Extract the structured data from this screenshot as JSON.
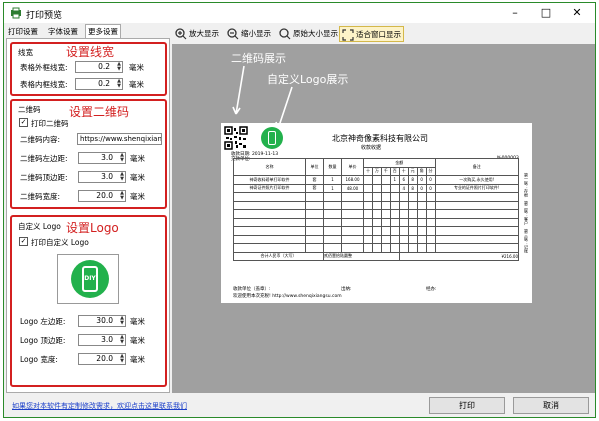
{
  "window": {
    "title": "打印预览",
    "minimize": "–",
    "maximize": "□",
    "close": "✕"
  },
  "tabs": [
    "打印设置",
    "字体设置",
    "更多设置"
  ],
  "line_group": {
    "header": "线宽",
    "annotation": "设置线宽",
    "outer_label": "表格外框线宽:",
    "outer_value": "0.2",
    "inner_label": "表格内框线宽:",
    "inner_value": "0.2",
    "unit": "毫米"
  },
  "qr_group": {
    "header": "二维码",
    "annotation": "设置二维码",
    "print_label": "打印二维码",
    "print_checked": "✓",
    "content_label": "二维码内容:",
    "content_value": "https://www.shenqixiangsu.com",
    "left_label": "二维码左边距:",
    "left_value": "3.0",
    "top_label": "二维码顶边距:",
    "top_value": "3.0",
    "width_label": "二维码宽度:",
    "width_value": "20.0",
    "unit": "毫米"
  },
  "logo_group": {
    "header": "自定义 Logo",
    "annotation": "设置Logo",
    "print_label": "打印自定义 Logo",
    "print_checked": "✓",
    "logo_text": "DIY",
    "left_label": "Logo 左边距:",
    "left_value": "30.0",
    "top_label": "Logo 顶边距:",
    "top_value": "3.0",
    "width_label": "Logo 宽度:",
    "width_value": "20.0",
    "unit": "毫米"
  },
  "toolbar": {
    "zoom_in": "放大显示",
    "zoom_out": "缩小显示",
    "original": "原始大小显示",
    "fit": "适合窗口显示"
  },
  "preview_annotations": {
    "qr": "二维码展示",
    "logo": "自定义Logo展示"
  },
  "receipt": {
    "company": "北京神奇像素科技有限公司",
    "subtitle": "收款收据",
    "date": "收款日期:   2019-11-13",
    "payer": "交款单位:",
    "number": "№000003",
    "col_name": "名称",
    "col_unit": "单位",
    "col_qty": "数量",
    "col_price": "单价",
    "col_amount": "金额",
    "col_note": "备注",
    "digits": [
      "十",
      "万",
      "千",
      "百",
      "十",
      "元",
      "角",
      "分"
    ],
    "rows": [
      {
        "name": "神奇收料磅单打印软件",
        "unit": "套",
        "qty": "1",
        "price": "168.00",
        "digits": [
          "",
          "",
          "",
          "1",
          "6",
          "8",
          "0",
          "0"
        ],
        "note": "一次购买,永久使用!"
      },
      {
        "name": "神奇证件照片打印软件",
        "unit": "套",
        "qty": "1",
        "price": "48.00",
        "digits": [
          "",
          "",
          "",
          "",
          "4",
          "8",
          "0",
          "0"
        ],
        "note": "专业的证件照片打印软件!"
      }
    ],
    "total_label": "合计人民币（大写）",
    "total_words": "贰佰壹拾陆圆整",
    "total_amount": "¥216.00",
    "payee": "收款单位（盖章）:",
    "cashier": "出纳:",
    "handler": "经办:",
    "welcome": "欢迎使用本次充税! http://www.shenqixiangsu.com",
    "side": "第一联：存根　第二联：客户　第三联：记账"
  },
  "status": {
    "link": "如果您对本软件有定制修改需求，欢迎点击这里联系我们",
    "print": "打印",
    "cancel": "取消"
  }
}
